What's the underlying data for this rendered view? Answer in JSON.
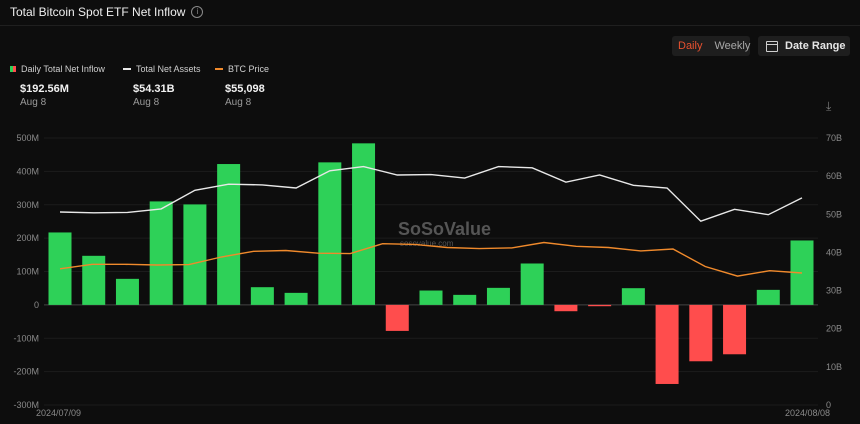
{
  "header": {
    "title": "Total Bitcoin Spot ETF Net Inflow",
    "info_icon": "info-circle-icon"
  },
  "controls": {
    "daily_label": "Daily",
    "weekly_label": "Weekly",
    "date_range_label": "Date Range",
    "date_range_icon": "calendar-icon",
    "active_color": "#e8512f"
  },
  "legend": [
    {
      "label": "Daily Total Net Inflow",
      "value": "$192.56M",
      "date": "Aug 8"
    },
    {
      "label": "Total Net Assets",
      "value": "$54.31B",
      "date": "Aug 8"
    },
    {
      "label": "BTC Price",
      "value": "$55,098",
      "date": "Aug 8"
    }
  ],
  "watermark": {
    "brand": "SoSoValue",
    "url": "sosovalue.com"
  },
  "chart_data": {
    "type": "bar",
    "x_start_label": "2024/07/09",
    "x_end_label": "2024/08/08",
    "left_axis": {
      "ticks": [
        "500M",
        "400M",
        "300M",
        "200M",
        "100M",
        "0",
        "-100M",
        "-200M",
        "-300M"
      ],
      "range": [
        -300,
        500
      ],
      "unit": "M USD"
    },
    "right_axis": {
      "ticks": [
        "70B",
        "60B",
        "50B",
        "40B",
        "30B",
        "20B",
        "10B",
        "0"
      ],
      "range": [
        0,
        70
      ],
      "unit": "B USD"
    },
    "colors": {
      "positive": "#2ed158",
      "negative": "#ff4d4d",
      "net_assets": "#e8e8e8",
      "btc_price": "#f08a2c"
    },
    "series": [
      {
        "name": "Daily Total Net Inflow",
        "values": [
          217,
          147,
          78,
          310,
          301,
          422,
          53,
          36,
          427,
          484,
          -78,
          43,
          30,
          51,
          124,
          -19,
          -4,
          50,
          -237,
          -169,
          -148,
          45,
          193
        ]
      },
      {
        "name": "Total Net Assets",
        "values": [
          50.6,
          50.4,
          50.5,
          51.4,
          56.3,
          57.9,
          57.7,
          56.9,
          61.4,
          62.5,
          60.3,
          60.4,
          59.5,
          62.5,
          62.2,
          58.4,
          60.3,
          57.6,
          56.9,
          48.2,
          51.3,
          49.9,
          54.3
        ]
      },
      {
        "name": "BTC Price",
        "values": [
          35.7,
          36.9,
          36.9,
          36.7,
          36.8,
          38.8,
          40.3,
          40.5,
          39.8,
          39.7,
          42.3,
          42.1,
          41.3,
          41.0,
          41.2,
          42.6,
          41.6,
          41.3,
          40.4,
          40.9,
          36.3,
          33.8,
          35.2,
          34.6
        ]
      }
    ]
  }
}
